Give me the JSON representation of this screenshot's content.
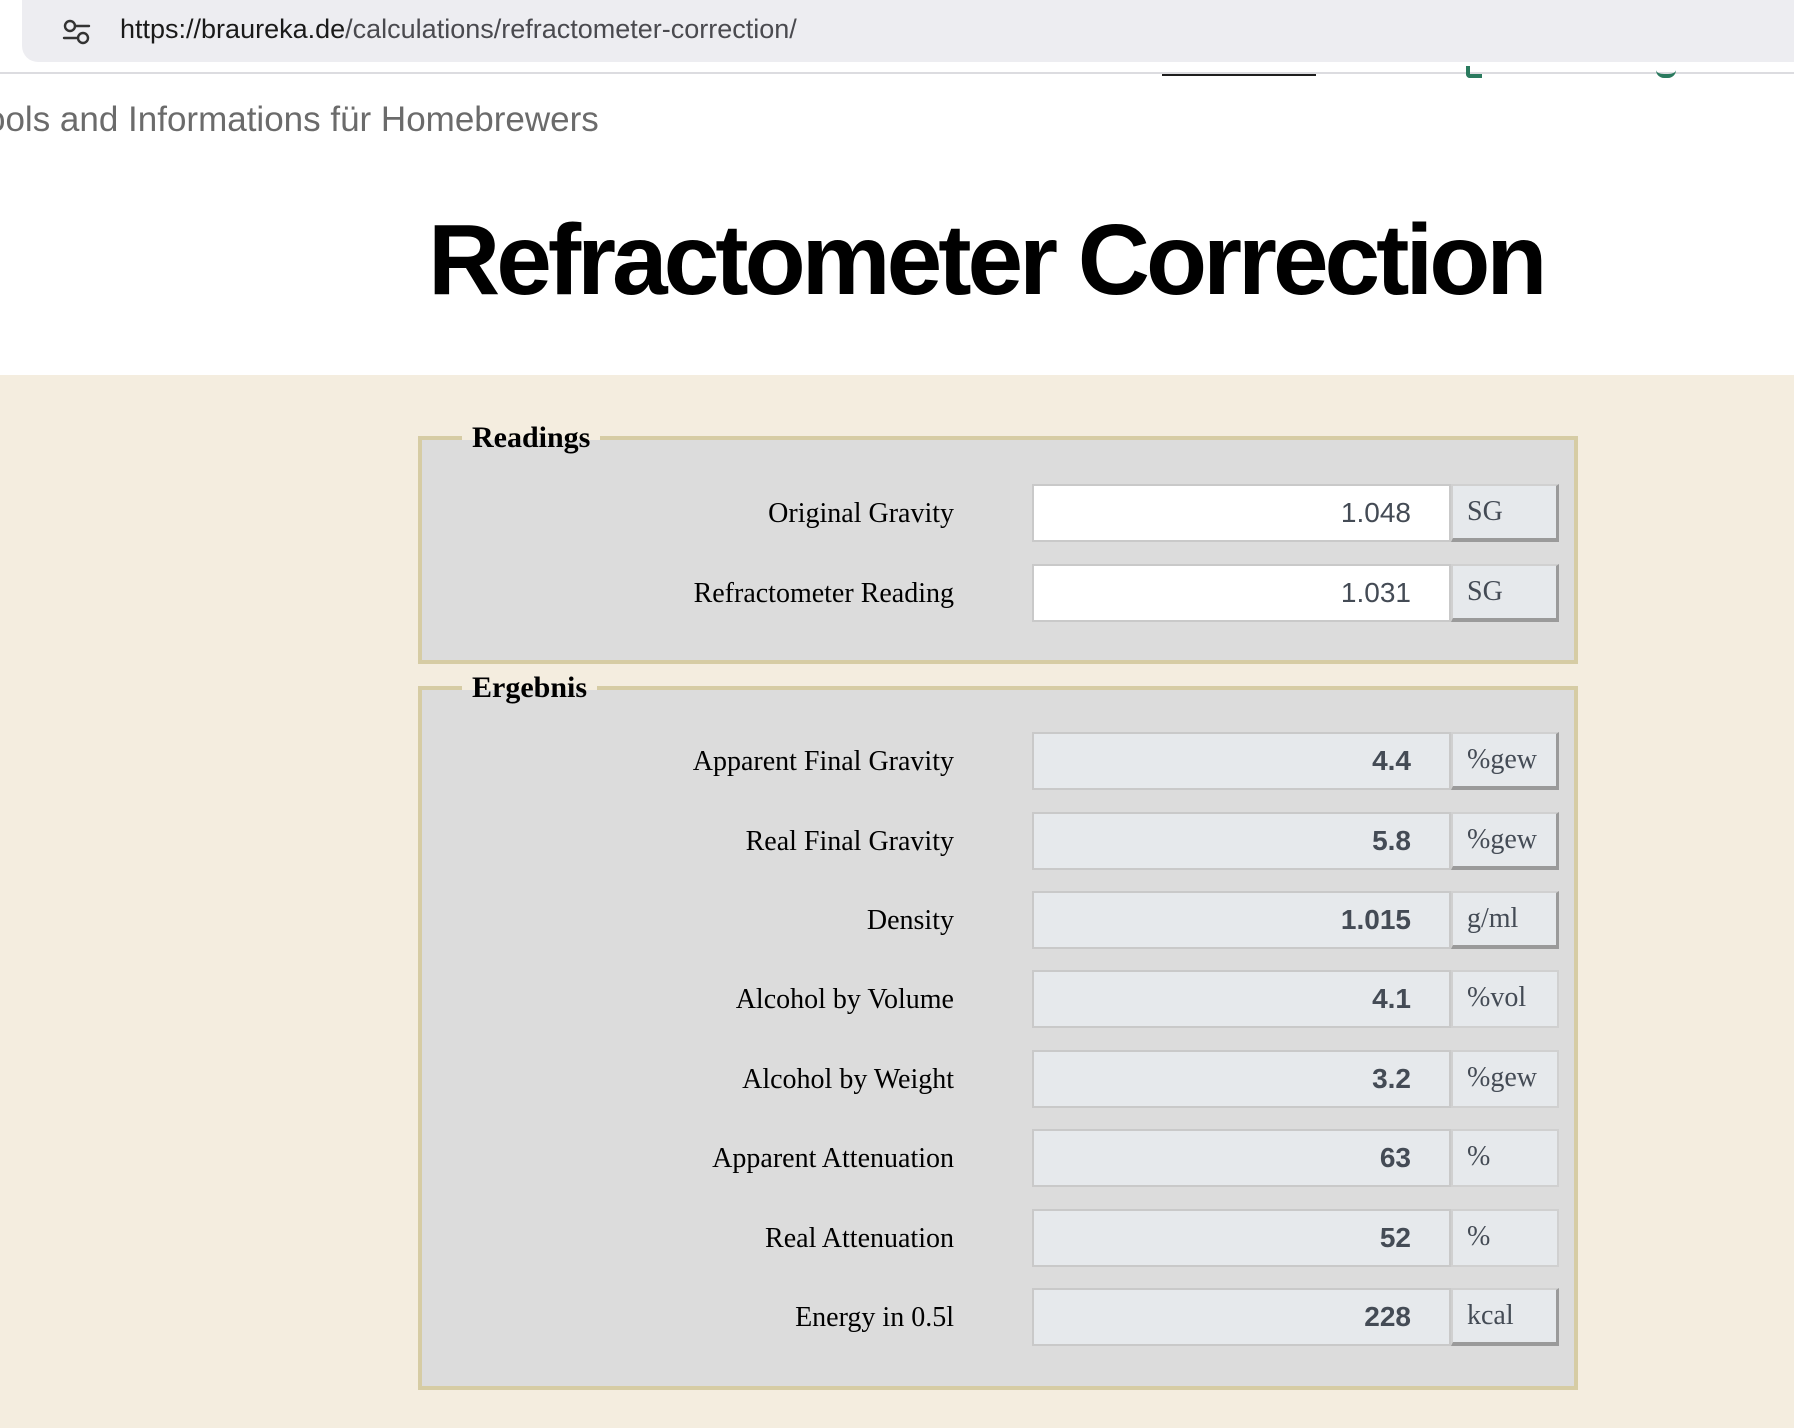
{
  "browser": {
    "url_host": "https://braureka.de",
    "url_path": "/calculations/refractometer-correction/"
  },
  "header": {
    "tagline": "ools and Informations für Homebrewers"
  },
  "page": {
    "title": "Refractometer Correction"
  },
  "readings": {
    "legend": "Readings",
    "fields": [
      {
        "label": "Original Gravity",
        "value": "1.048",
        "unit": "SG"
      },
      {
        "label": "Refractometer Reading",
        "value": "1.031",
        "unit": "SG"
      }
    ]
  },
  "results": {
    "legend": "Ergebnis",
    "fields": [
      {
        "label": "Apparent Final Gravity",
        "value": "4.4",
        "unit": "%gew"
      },
      {
        "label": "Real Final Gravity",
        "value": "5.8",
        "unit": "%gew"
      },
      {
        "label": "Density",
        "value": "1.015",
        "unit": "g/ml"
      },
      {
        "label": "Alcohol by Volume",
        "value": "4.1",
        "unit": "%vol"
      },
      {
        "label": "Alcohol by Weight",
        "value": "3.2",
        "unit": "%gew"
      },
      {
        "label": "Apparent Attenuation",
        "value": "63",
        "unit": "%"
      },
      {
        "label": "Real Attenuation",
        "value": "52",
        "unit": "%"
      },
      {
        "label": "Energy in 0.5l",
        "value": "228",
        "unit": "kcal"
      }
    ]
  },
  "colors": {
    "content_background": "#f4eddf",
    "fieldset_background": "#dcdcdc",
    "fieldset_border": "#d6cca4",
    "output_field_background": "#e6e9ec",
    "nav_accent": "#2a7a5e"
  },
  "icons": {
    "address_bar": "site-info-icon"
  }
}
